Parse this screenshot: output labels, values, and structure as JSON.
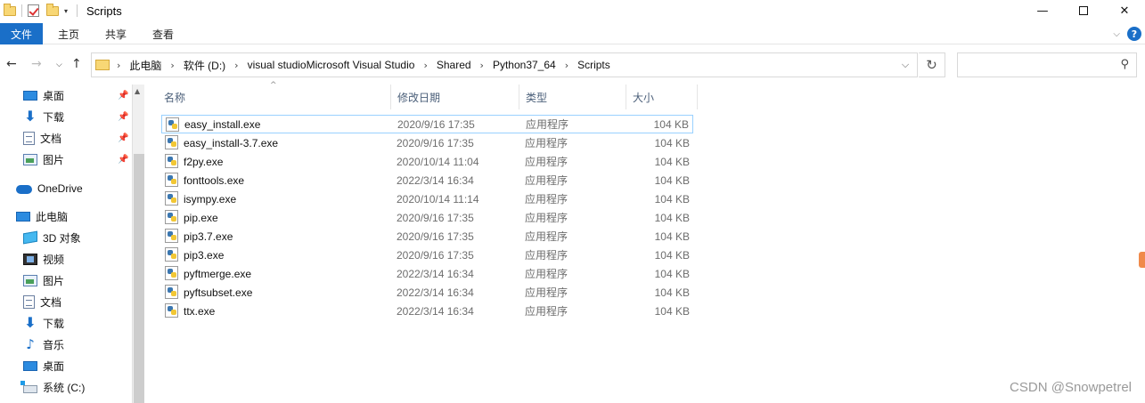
{
  "window": {
    "title": "Scripts",
    "controls": {
      "minimize": "—",
      "maximize": "",
      "close": "✕"
    }
  },
  "ribbon": {
    "tabs": [
      "文件",
      "主页",
      "共享",
      "查看"
    ],
    "help": "?"
  },
  "address": {
    "crumbs": [
      "此电脑",
      "软件 (D:)",
      "visual studioMicrosoft Visual Studio",
      "Shared",
      "Python37_64",
      "Scripts"
    ],
    "search_placeholder": ""
  },
  "sidebar": {
    "quick_access": [
      {
        "label": "桌面",
        "icon": "desktop-icon",
        "pinned": true
      },
      {
        "label": "下载",
        "icon": "download-icon",
        "pinned": true
      },
      {
        "label": "文档",
        "icon": "document-icon",
        "pinned": true
      },
      {
        "label": "图片",
        "icon": "picture-icon",
        "pinned": true
      }
    ],
    "onedrive": "OneDrive",
    "this_pc": "此电脑",
    "pc_items": [
      {
        "label": "3D 对象",
        "icon": "3d-objects-icon"
      },
      {
        "label": "视频",
        "icon": "video-icon"
      },
      {
        "label": "图片",
        "icon": "picture-icon"
      },
      {
        "label": "文档",
        "icon": "document-icon"
      },
      {
        "label": "下载",
        "icon": "download-icon"
      },
      {
        "label": "音乐",
        "icon": "music-icon"
      },
      {
        "label": "桌面",
        "icon": "desktop-icon"
      },
      {
        "label": "系统 (C:)",
        "icon": "drive-icon"
      }
    ]
  },
  "columns": {
    "name": "名称",
    "date": "修改日期",
    "type": "类型",
    "size": "大小"
  },
  "files": [
    {
      "name": "easy_install.exe",
      "date": "2020/9/16 17:35",
      "type": "应用程序",
      "size": "104 KB"
    },
    {
      "name": "easy_install-3.7.exe",
      "date": "2020/9/16 17:35",
      "type": "应用程序",
      "size": "104 KB"
    },
    {
      "name": "f2py.exe",
      "date": "2020/10/14 11:04",
      "type": "应用程序",
      "size": "104 KB"
    },
    {
      "name": "fonttools.exe",
      "date": "2022/3/14 16:34",
      "type": "应用程序",
      "size": "104 KB"
    },
    {
      "name": "isympy.exe",
      "date": "2020/10/14 11:14",
      "type": "应用程序",
      "size": "104 KB"
    },
    {
      "name": "pip.exe",
      "date": "2020/9/16 17:35",
      "type": "应用程序",
      "size": "104 KB"
    },
    {
      "name": "pip3.7.exe",
      "date": "2020/9/16 17:35",
      "type": "应用程序",
      "size": "104 KB"
    },
    {
      "name": "pip3.exe",
      "date": "2020/9/16 17:35",
      "type": "应用程序",
      "size": "104 KB"
    },
    {
      "name": "pyftmerge.exe",
      "date": "2022/3/14 16:34",
      "type": "应用程序",
      "size": "104 KB"
    },
    {
      "name": "pyftsubset.exe",
      "date": "2022/3/14 16:34",
      "type": "应用程序",
      "size": "104 KB"
    },
    {
      "name": "ttx.exe",
      "date": "2022/3/14 16:34",
      "type": "应用程序",
      "size": "104 KB"
    }
  ],
  "watermark": "CSDN @Snowpetrel",
  "colors": {
    "accent": "#1a6fc8",
    "selection_border": "#99d1ff"
  }
}
